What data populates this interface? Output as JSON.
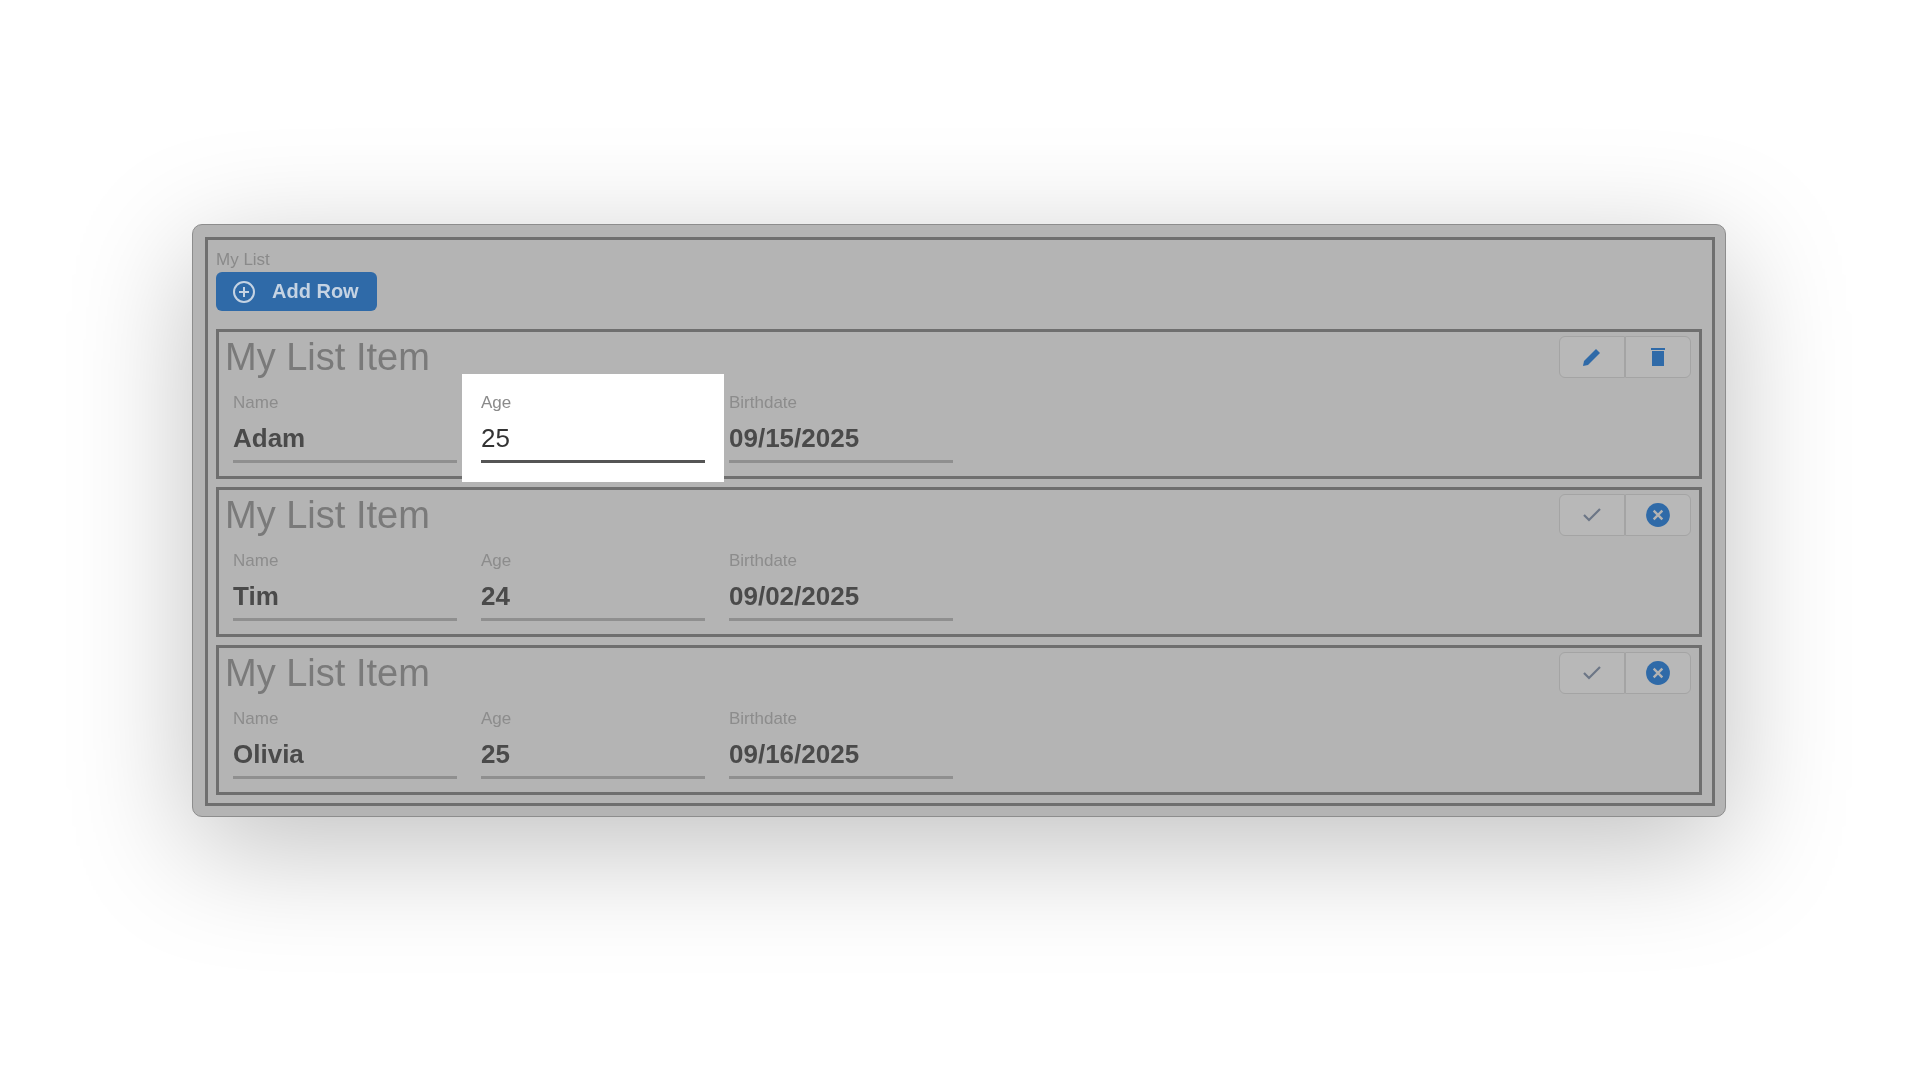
{
  "list": {
    "title": "My List",
    "add_button": "Add Row"
  },
  "items": [
    {
      "title": "My List Item",
      "kind": "view",
      "fields": [
        {
          "label": "Name",
          "value": "Adam",
          "highlighted": false
        },
        {
          "label": "Age",
          "value": "25",
          "highlighted": true
        },
        {
          "label": "Birthdate",
          "value": "09/15/2025",
          "highlighted": false
        }
      ]
    },
    {
      "title": "My List Item",
      "kind": "edit",
      "fields": [
        {
          "label": "Name",
          "value": "Tim",
          "highlighted": false
        },
        {
          "label": "Age",
          "value": "24",
          "highlighted": false
        },
        {
          "label": "Birthdate",
          "value": "09/02/2025",
          "highlighted": false
        }
      ]
    },
    {
      "title": "My List Item",
      "kind": "edit",
      "fields": [
        {
          "label": "Name",
          "value": "Olivia",
          "highlighted": false
        },
        {
          "label": "Age",
          "value": "25",
          "highlighted": false
        },
        {
          "label": "Birthdate",
          "value": "09/16/2025",
          "highlighted": false
        }
      ]
    }
  ]
}
